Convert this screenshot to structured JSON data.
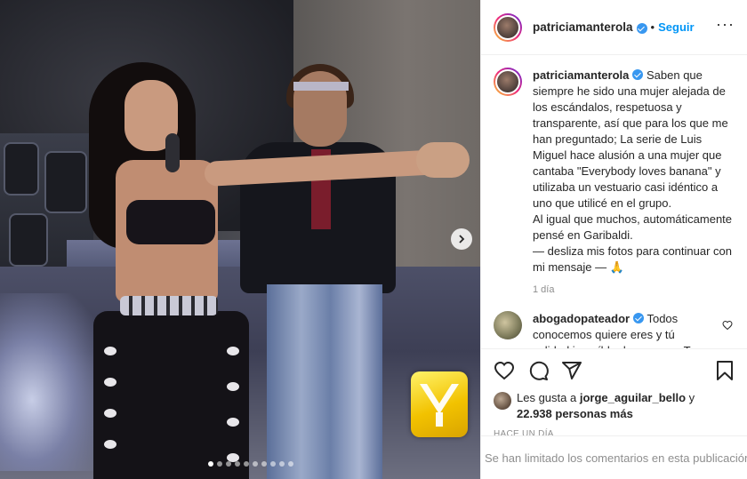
{
  "post": {
    "username": "patriciamanterola",
    "follow_label": "Seguir",
    "bullet": "•",
    "more_icon": "more-horizontal-icon"
  },
  "caption": {
    "username": "patriciamanterola",
    "text": "Saben que siempre he sido una mujer alejada de los escándalos, respetuosa y transparente, así que para los que me han preguntado; La serie de Luis Miguel hace alusión a una mujer que cantaba \"Everybody loves banana\" y utilizaba un vestuario casi idéntico a uno que utilicé en el grupo.",
    "text2": "Al igual que muchos, automáticamente pensé en Garibaldi.",
    "text3": "— desliza mis fotos para continuar con mi mensaje —",
    "emoji": "🙏",
    "time": "1 día"
  },
  "comment": {
    "username": "abogadopateador",
    "text": "Todos conocemos quiere eres y tú calidad increíble de persona. Te"
  },
  "actions": {
    "icons": [
      "heart-icon",
      "comment-icon",
      "share-icon",
      "bookmark-icon"
    ]
  },
  "likes": {
    "prefix": "Les gusta a",
    "user": "jorge_aguilar_bello",
    "connector": "y",
    "count": "22.938 personas más"
  },
  "time_label": "Hace un día",
  "comments_limited": "Se han limitado los comentarios en esta publicación.",
  "carousel": {
    "total": 10,
    "current": 1
  },
  "colors": {
    "accent": "#0095f6",
    "verified": "#3897f0",
    "muted": "#8e8e8e"
  }
}
